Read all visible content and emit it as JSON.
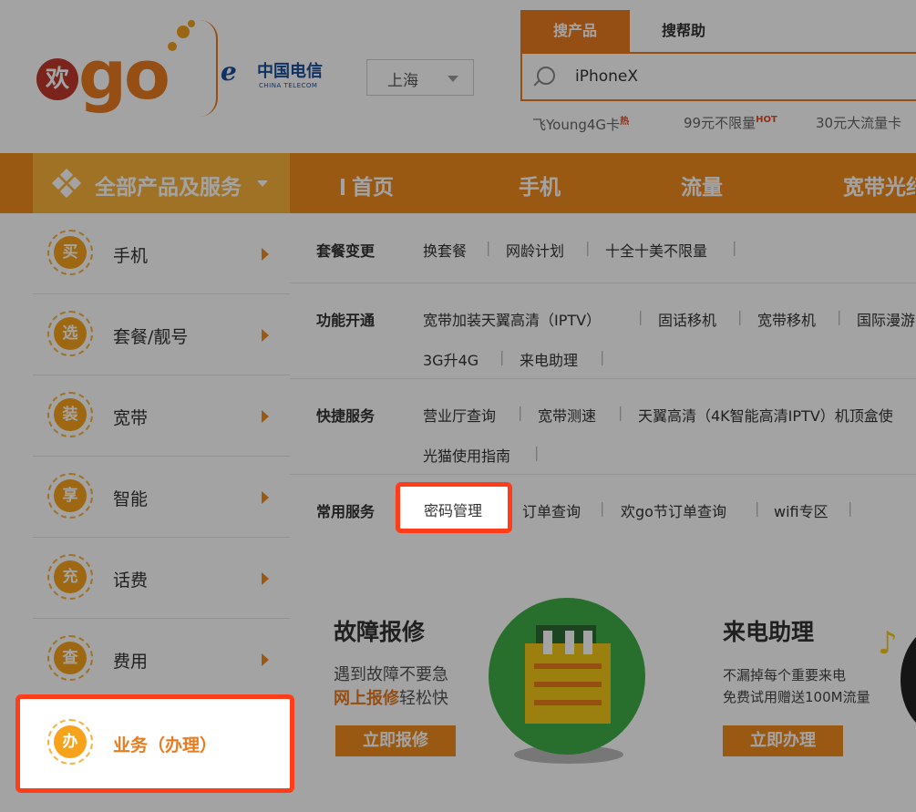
{
  "header": {
    "logo_text": "go",
    "logo_badge": "欢",
    "carrier_name": "中国电信",
    "carrier_en": "CHINA TELECOM",
    "city": "上海"
  },
  "search": {
    "tabs": [
      "搜产品",
      "搜帮助"
    ],
    "value": "iPhoneX",
    "hot": [
      {
        "label": "飞Young4G卡",
        "tag": "热"
      },
      {
        "label": "99元不限量",
        "tag": "HOT"
      },
      {
        "label": "30元大流量卡",
        "tag": ""
      }
    ]
  },
  "nav": {
    "all_label": "全部产品及服务",
    "items": [
      "首页",
      "手机",
      "流量",
      "宽带光纤"
    ]
  },
  "sidebar": {
    "items": [
      {
        "badge": "买",
        "label": "手机"
      },
      {
        "badge": "选",
        "label": "套餐/靓号"
      },
      {
        "badge": "装",
        "label": "宽带"
      },
      {
        "badge": "享",
        "label": "智能"
      },
      {
        "badge": "充",
        "label": "话费"
      },
      {
        "badge": "查",
        "label": "费用"
      },
      {
        "badge": "办",
        "label": "业务（办理）"
      }
    ]
  },
  "services": {
    "rows": [
      {
        "title": "套餐变更",
        "links": [
          "换套餐",
          "网龄计划",
          "十全十美不限量"
        ]
      },
      {
        "title": "功能开通",
        "links": [
          "宽带加装天翼高清（IPTV）",
          "固话移机",
          "宽带移机",
          "国际漫游",
          "3G升4G",
          "来电助理"
        ]
      },
      {
        "title": "快捷服务",
        "links": [
          "营业厅查询",
          "宽带测速",
          "天翼高清（4K智能高清IPTV）机顶盒使",
          "光猫使用指南"
        ]
      },
      {
        "title": "常用服务",
        "links": [
          "密码管理",
          "订单查询",
          "欢go节订单查询",
          "wifi专区"
        ]
      }
    ]
  },
  "promos": [
    {
      "title": "故障报修",
      "line1": "遇到故障不要急",
      "line2_hl": "网上报修",
      "line2_rest": "轻松快",
      "button": "立即报修"
    },
    {
      "title": "来电助理",
      "line1": "不漏掉每个重要来电",
      "line2": "免费试用赠送100M流量",
      "button": "立即办理"
    }
  ],
  "colors": {
    "brand_orange": "#f18c1f",
    "sidebar_header": "#fbb33b",
    "highlight_red": "#ff3d1a"
  }
}
